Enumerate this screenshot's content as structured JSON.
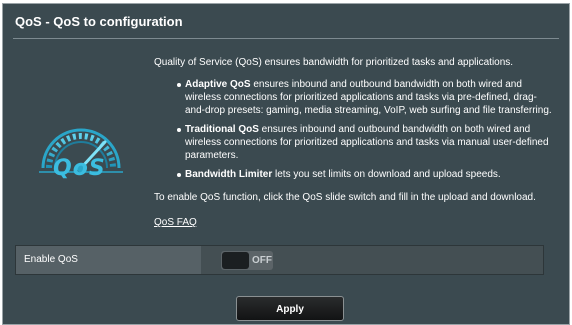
{
  "panel": {
    "title": "QoS - QoS to configuration"
  },
  "logo": {
    "icon": "qos-speedometer-icon",
    "text": "QoS",
    "color": "#2aa6c9"
  },
  "description": {
    "intro": "Quality of Service (QoS) ensures bandwidth for prioritized tasks and applications.",
    "bullets": [
      {
        "term": "Adaptive QoS",
        "text": " ensures inbound and outbound bandwidth on both wired and wireless connections for prioritized applications and tasks via pre-defined, drag-and-drop presets: gaming, media streaming, VoIP, web surfing and file transferring."
      },
      {
        "term": "Traditional QoS",
        "text": " ensures inbound and outbound bandwidth on both wired and wireless connections for prioritized applications and tasks via manual user-defined parameters."
      },
      {
        "term": "Bandwidth Limiter",
        "text": " lets you set limits on download and upload speeds."
      }
    ],
    "enable_text": "To enable QoS function, click the QoS slide switch and fill in the upload and download.",
    "faq_link": "QoS FAQ"
  },
  "enable_row": {
    "label": "Enable QoS",
    "toggle_state": "OFF"
  },
  "apply_button": {
    "label": "Apply"
  }
}
